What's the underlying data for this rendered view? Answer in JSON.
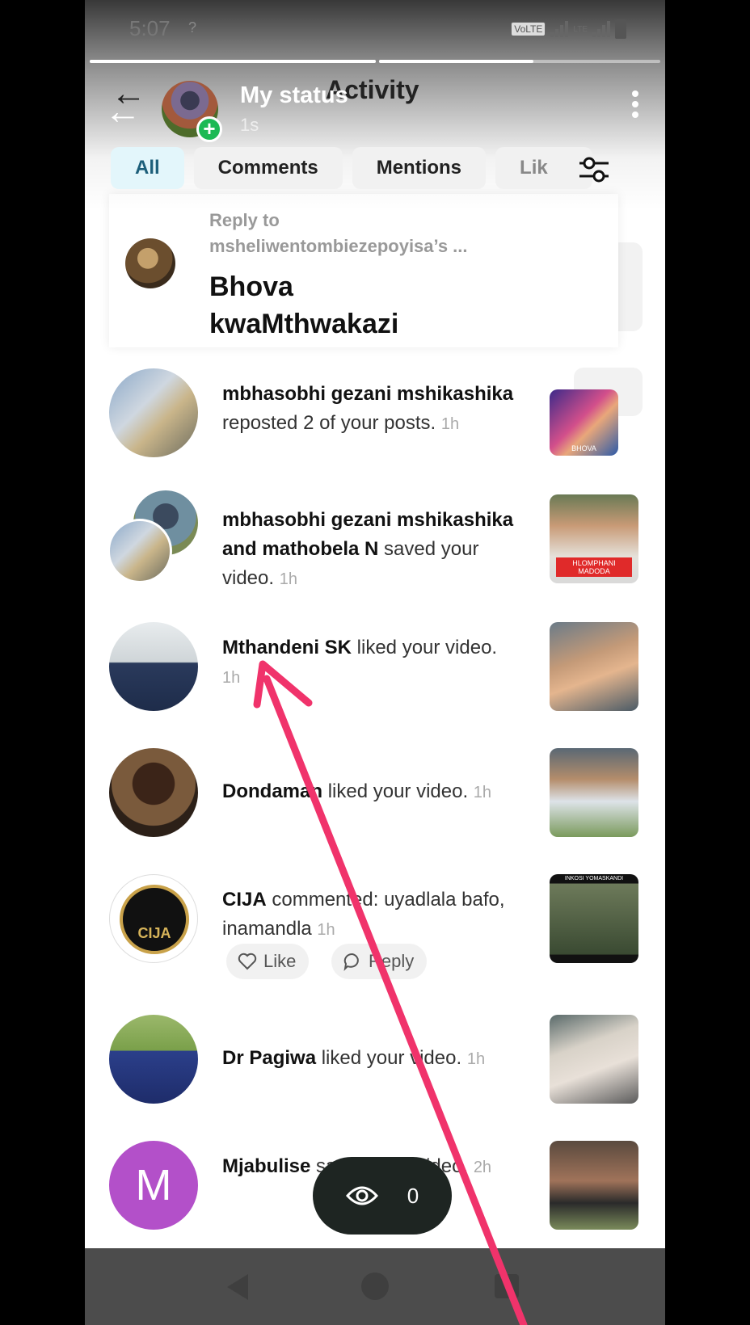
{
  "status_bar": {
    "time": "5:07",
    "net": "?",
    "volte": "VoLTE",
    "lte": "LTE"
  },
  "header": {
    "back_icon": "arrow-left-icon",
    "title": "My status",
    "underlay_title": "Activity",
    "elapsed": "1s",
    "more_icon": "more-vertical-icon"
  },
  "progress": [
    1.0,
    0.55
  ],
  "tabs": [
    {
      "label": "All",
      "active": true
    },
    {
      "label": "Comments"
    },
    {
      "label": "Mentions"
    },
    {
      "label": "Lik"
    }
  ],
  "filter_icon": "sliders-icon",
  "reply": {
    "label": "Reply to",
    "target": "msheliwentombiezepoyisa’s ...",
    "text": "Bhova kwaMthwakazi"
  },
  "items": [
    {
      "name": "mbhasobhi gezani mshikashika",
      "action": "reposted 2 of your posts.",
      "time": "1h",
      "thumb_caption": "BHOVA"
    },
    {
      "name": "mbhasobhi gezani mshikashika",
      "name_joiner": "and",
      "name2": "mathobela N",
      "action": "saved your video.",
      "time": "1h",
      "thumb_caption": "HLOMPHANI MADODA"
    },
    {
      "name": "Mthandeni SK",
      "action": "liked your video.",
      "time": "1h"
    },
    {
      "name": "Dondaman",
      "action": "liked your video.",
      "time": "1h"
    },
    {
      "name": "CIJA",
      "action": "commented: uyadlala bafo, inamandla",
      "time": "1h",
      "avatar_text": "CIJA",
      "thumb_caption": "INKOSI YOMASKANDI",
      "like_label": "Like",
      "reply_label": "Reply"
    },
    {
      "name": "Dr Pagiwa",
      "action": "liked your video.",
      "time": "1h"
    },
    {
      "name": "Mjabulise",
      "action": "saved your video.",
      "time": "2h",
      "avatar_letter": "M"
    }
  ],
  "view_counter": {
    "icon": "eye-icon",
    "count": "0"
  },
  "colors": {
    "accent_pink": "#f0336b",
    "plus_green": "#1db954",
    "avatar_purple": "#b350c9"
  }
}
